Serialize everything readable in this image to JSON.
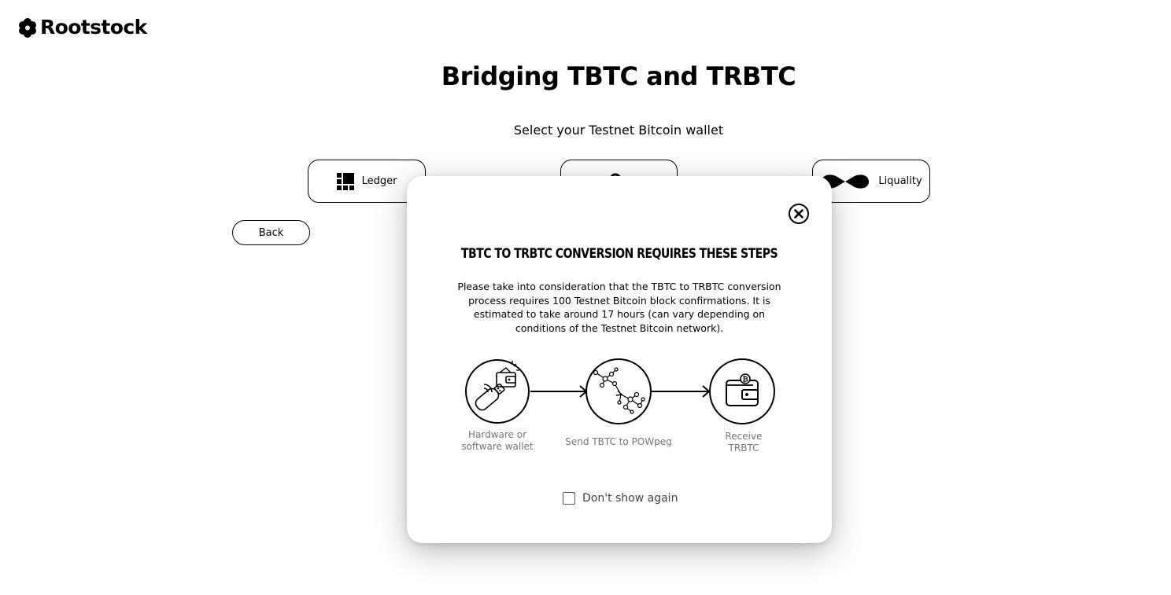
{
  "brand": {
    "name": "Rootstock"
  },
  "page": {
    "title": "Bridging TBTC and TRBTC",
    "subtitle": "Select your Testnet Bitcoin wallet"
  },
  "wallets": [
    {
      "label": "Ledger",
      "icon": "ledger-icon"
    },
    {
      "label": "",
      "icon": "trezor-icon"
    },
    {
      "label": "Liquality",
      "icon": "liquality-icon"
    }
  ],
  "back_label": "Back",
  "modal": {
    "title": "TBTC TO TRBTC CONVERSION REQUIRES THESE STEPS",
    "text": "Please take into consideration that the TBTC to TRBTC conversion process requires 100 Testnet Bitcoin block confirmations. It is estimated to take around 17 hours (can vary depending on conditions of the Testnet Bitcoin network).",
    "steps": [
      {
        "line1": "Hardware or",
        "line2": "software wallet",
        "icon": "hardware-wallet-icon"
      },
      {
        "line1": "Send TBTC to POWpeg",
        "line2": "",
        "icon": "network-icon"
      },
      {
        "line1": "Receive",
        "line2": "TRBTC",
        "icon": "wallet-bitcoin-icon"
      }
    ],
    "dont_show_label": "Don't show again",
    "dont_show_checked": false
  }
}
